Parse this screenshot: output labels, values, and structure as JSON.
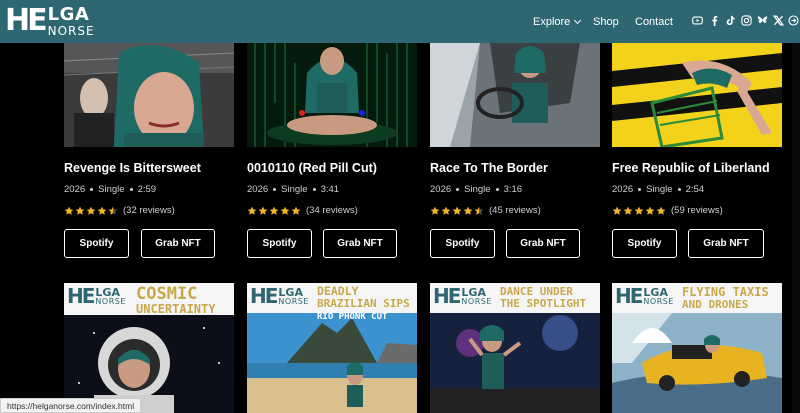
{
  "header": {
    "logo_mark": "HE",
    "logo_top": "LGA",
    "logo_bottom": "NORSE",
    "nav": {
      "explore": "Explore",
      "shop": "Shop",
      "contact": "Contact"
    },
    "social_icons": [
      "youtube-icon",
      "facebook-icon",
      "tiktok-icon",
      "instagram-icon",
      "bluesky-icon",
      "x-icon",
      "external-arrow-icon"
    ]
  },
  "colors": {
    "header_bg": "#2e6672",
    "star": "#f0b429",
    "title_gold": "#c9a84c"
  },
  "cards": [
    {
      "title": "Revenge Is Bittersweet",
      "year": "2026",
      "type": "Single",
      "duration": "2:59",
      "rating": 4.5,
      "reviews": "(32 reviews)",
      "spotify": "Spotify",
      "nft": "Grab NFT"
    },
    {
      "title": "0010110 (Red Pill Cut)",
      "year": "2026",
      "type": "Single",
      "duration": "3:41",
      "rating": 5,
      "reviews": "(34 reviews)",
      "spotify": "Spotify",
      "nft": "Grab NFT"
    },
    {
      "title": "Race To The Border",
      "year": "2026",
      "type": "Single",
      "duration": "3:16",
      "rating": 4.5,
      "reviews": "(45 reviews)",
      "spotify": "Spotify",
      "nft": "Grab NFT"
    },
    {
      "title": "Free Republic of Liberland",
      "year": "2026",
      "type": "Single",
      "duration": "2:54",
      "rating": 5,
      "reviews": "(59 reviews)",
      "spotify": "Spotify",
      "nft": "Grab NFT"
    }
  ],
  "bottom_cards": [
    {
      "line1": "COSMIC",
      "line2": "UNCERTAINTY",
      "line3": ""
    },
    {
      "line1": "DEADLY",
      "line2": "BRAZILIAN SIPS",
      "line3": "RIO PHONK CUT"
    },
    {
      "line1": "DANCE UNDER",
      "line2": "THE SPOTLIGHT",
      "line3": ""
    },
    {
      "line1": "FLYING TAXIS",
      "line2": "AND DRONES",
      "line3": ""
    }
  ],
  "status_url": "https://helganorse.com/index.html"
}
